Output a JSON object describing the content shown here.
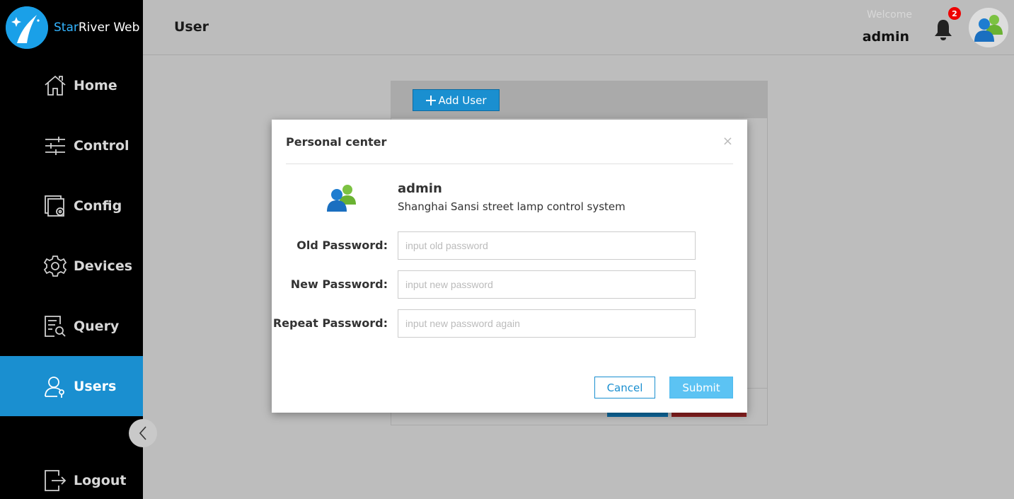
{
  "app": {
    "brand_part1": "Star",
    "brand_part2": "River Web",
    "accent": "#1a8fd0"
  },
  "sidebar": {
    "items": [
      {
        "label": "Home",
        "icon": "home-icon",
        "active": false
      },
      {
        "label": "Control",
        "icon": "sliders-icon",
        "active": false
      },
      {
        "label": "Config",
        "icon": "config-icon",
        "active": false
      },
      {
        "label": "Devices",
        "icon": "gear-icon",
        "active": false
      },
      {
        "label": "Query",
        "icon": "query-icon",
        "active": false
      },
      {
        "label": "Users",
        "icon": "user-icon",
        "active": true
      }
    ],
    "logout_label": "Logout"
  },
  "header": {
    "title": "User",
    "welcome": "Welcome",
    "username": "admin",
    "notification_count": "2"
  },
  "panel": {
    "add_user_label": "Add User"
  },
  "modal": {
    "title": "Personal center",
    "close": "×",
    "profile_name": "admin",
    "profile_desc": "Shanghai Sansi street lamp control system",
    "fields": [
      {
        "label": "Old Password:",
        "placeholder": "input old password",
        "value": ""
      },
      {
        "label": "New Password:",
        "placeholder": "input new password",
        "value": ""
      },
      {
        "label": "Repeat Password:",
        "placeholder": "input new password again",
        "value": ""
      }
    ],
    "cancel_label": "Cancel",
    "submit_label": "Submit"
  }
}
